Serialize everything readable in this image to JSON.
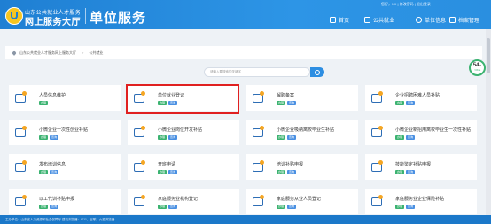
{
  "header": {
    "logo_line1": "山东公共就业人才服务",
    "logo_line2": "网上服务大厅",
    "unit_title": "单位服务",
    "top_links": "您好，XX | 修改密码 | 退出登录",
    "nav": [
      {
        "label": "首页",
        "icon": "home-icon"
      },
      {
        "label": "公共就业",
        "icon": "employment-icon"
      },
      {
        "label": "单位信息",
        "icon": "user-icon"
      },
      {
        "label": "档案管理",
        "icon": "archive-icon"
      }
    ]
  },
  "breadcrumb": {
    "items": [
      "山东公共就业人才服务网上服务大厅",
      "公共就业"
    ],
    "separator": ">"
  },
  "search": {
    "placeholder": "请输入要搜索的关键字"
  },
  "gauge": {
    "value": "54",
    "unit": "%",
    "sub": "↑0K/s"
  },
  "services": [
    {
      "name": "人员信息维护",
      "tags": [
        "办理"
      ],
      "icon": "person-icon"
    },
    {
      "name": "单位就业登记",
      "tags": [
        "办理",
        "查询"
      ],
      "icon": "register-card-icon",
      "highlighted": true
    },
    {
      "name": "解聘备案",
      "tags": [
        "办理",
        "查询"
      ],
      "icon": "briefcase-icon"
    },
    {
      "name": "企业招聘困难人员补贴",
      "tags": [
        "办理",
        "查询"
      ],
      "icon": "person-icon"
    },
    {
      "name": "小微企业一次性创业补贴",
      "tags": [
        "办理",
        "查询"
      ],
      "icon": "chat-icon"
    },
    {
      "name": "小微企业岗位开发补贴",
      "tags": [
        "办理",
        "查询"
      ],
      "icon": "briefcase-icon"
    },
    {
      "name": "小微企业吸纳离校毕业生补贴",
      "tags": [
        "办理",
        "查询"
      ],
      "icon": "document-icon"
    },
    {
      "name": "小微企业新招用离校毕业生一次性补贴",
      "tags": [
        "办理",
        "查询"
      ],
      "icon": "document-icon"
    },
    {
      "name": "发布培训信息",
      "tags": [
        "办理",
        "查询"
      ],
      "icon": "megaphone-icon"
    },
    {
      "name": "开班申请",
      "tags": [
        "办理",
        "查询"
      ],
      "icon": "board-icon"
    },
    {
      "name": "培训补贴申报",
      "tags": [
        "办理",
        "查询"
      ],
      "icon": "briefcase-icon"
    },
    {
      "name": "技能鉴定补贴申报",
      "tags": [
        "办理",
        "查询"
      ],
      "icon": "badge-icon"
    },
    {
      "name": "以工代训补贴申报",
      "tags": [
        "办理",
        "查询"
      ],
      "icon": "group-icon"
    },
    {
      "name": "家庭服务业机构登记",
      "tags": [
        "办理",
        "查询"
      ],
      "icon": "person-icon"
    },
    {
      "name": "家庭服务从业人员登记",
      "tags": [
        "办理",
        "查询"
      ],
      "icon": "person-icon"
    },
    {
      "name": "家庭服务业企业保险补贴",
      "tags": [
        "办理",
        "查询"
      ],
      "icon": "card-icon"
    }
  ],
  "footer": {
    "text": "主办单位：山东省人力资源和社会保障厅    建议浏览器：IE11、谷歌、火狐浏览器"
  },
  "colors": {
    "header": "#1f7fd3",
    "tag_green": "#3cb371",
    "tag_blue": "#4a90e2",
    "highlight": "#e02020"
  }
}
